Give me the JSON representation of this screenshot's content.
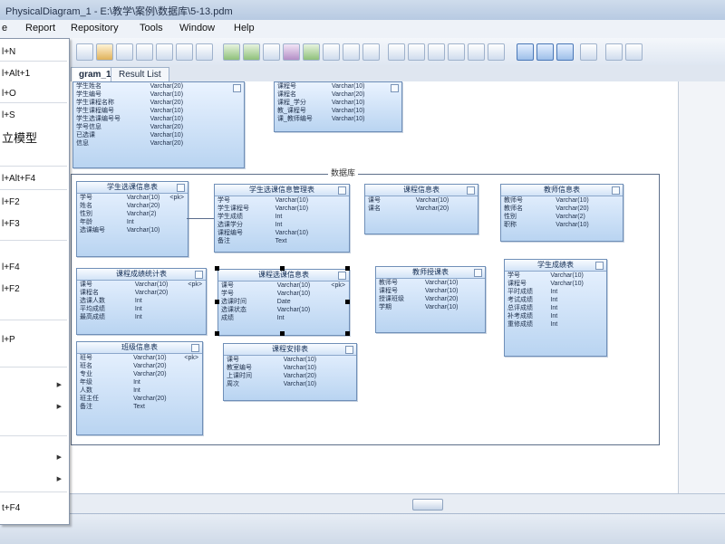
{
  "window": {
    "title": "PhysicalDiagram_1 - E:\\教学\\案例\\数据库\\5-13.pdm"
  },
  "menubar": {
    "items": [
      "e",
      "Report",
      "Repository",
      "Tools",
      "Window",
      "Help"
    ]
  },
  "tabs": [
    {
      "label": "gram_1",
      "active": true
    },
    {
      "label": "Result List",
      "active": false
    }
  ],
  "context_menu": {
    "items": [
      {
        "label": "l+N",
        "big": false,
        "arrow": false
      },
      {
        "label": "l+Alt+1",
        "big": false,
        "arrow": false
      },
      {
        "label": "l+O",
        "big": false,
        "arrow": false
      },
      {
        "label": "l+S",
        "big": false,
        "arrow": false
      },
      {
        "label": "立模型",
        "big": true,
        "arrow": false
      },
      {
        "label": "l+Alt+F4",
        "big": false,
        "arrow": false
      },
      {
        "label": "l+F2",
        "big": false,
        "arrow": false
      },
      {
        "label": "l+F3",
        "big": false,
        "arrow": false
      },
      {
        "label": "l+F4",
        "big": false,
        "arrow": false
      },
      {
        "label": "l+F2",
        "big": false,
        "arrow": false
      },
      {
        "label": "l+P",
        "big": false,
        "arrow": false
      },
      {
        "label": "",
        "big": false,
        "arrow": true
      },
      {
        "label": "",
        "big": false,
        "arrow": true
      },
      {
        "label": "",
        "big": false,
        "arrow": true
      },
      {
        "label": "",
        "big": false,
        "arrow": true
      },
      {
        "label": "t+F4",
        "big": false,
        "arrow": false
      }
    ]
  },
  "diagram": {
    "package_label": "数据库",
    "entities": [
      {
        "title": "",
        "rows": [
          [
            "学生姓名",
            "Varchar(20)",
            ""
          ],
          [
            "学生编号",
            "Varchar(10)",
            ""
          ],
          [
            "学生课程名称",
            "Varchar(20)",
            ""
          ],
          [
            "学生课程编号",
            "Varchar(10)",
            ""
          ],
          [
            "学生选课编号号",
            "Varchar(10)",
            ""
          ],
          [
            "学号信息",
            "Varchar(20)",
            ""
          ],
          [
            "已选课",
            "Varchar(10)",
            ""
          ],
          [
            "信息",
            "Varchar(20)",
            ""
          ]
        ]
      },
      {
        "title": "",
        "rows": [
          [
            "课程号",
            "Varchar(10)",
            ""
          ],
          [
            "课程名",
            "Varchar(20)",
            ""
          ],
          [
            "课程_学分",
            "Varchar(10)",
            ""
          ],
          [
            "教_课程号",
            "Varchar(10)",
            ""
          ],
          [
            "课_教师编号",
            "Varchar(10)",
            ""
          ]
        ]
      },
      {
        "title": "学生选课信息表",
        "rows": [
          [
            "学号",
            "Varchar(10)",
            "<pk>"
          ],
          [
            "姓名",
            "Varchar(20)",
            ""
          ],
          [
            "性别",
            "Varchar(2)",
            ""
          ],
          [
            "年龄",
            "Int",
            ""
          ],
          [
            "选课编号",
            "Varchar(10)",
            ""
          ]
        ]
      },
      {
        "title": "学生选课信息管理表",
        "rows": [
          [
            "学号",
            "Varchar(10)",
            ""
          ],
          [
            "学生课程号",
            "Varchar(10)",
            ""
          ],
          [
            "学生成绩",
            "Int",
            ""
          ],
          [
            "选课学分",
            "Int",
            ""
          ],
          [
            "课程编号",
            "Varchar(10)",
            ""
          ],
          [
            "备注",
            "Text",
            ""
          ]
        ]
      },
      {
        "title": "课程信息表",
        "rows": [
          [
            "课号",
            "Varchar(10)",
            ""
          ],
          [
            "课名",
            "Varchar(20)",
            ""
          ]
        ]
      },
      {
        "title": "教师信息表",
        "rows": [
          [
            "教师号",
            "Varchar(10)",
            ""
          ],
          [
            "教师名",
            "Varchar(20)",
            ""
          ],
          [
            "性别",
            "Varchar(2)",
            ""
          ],
          [
            "职称",
            "Varchar(10)",
            ""
          ]
        ]
      },
      {
        "title": "课程成绩统计表",
        "rows": [
          [
            "课号",
            "Varchar(10)",
            "<pk>"
          ],
          [
            "课程名",
            "Varchar(20)",
            ""
          ],
          [
            "选课人数",
            "Int",
            ""
          ],
          [
            "平均成绩",
            "Int",
            ""
          ],
          [
            "最高成绩",
            "Int",
            ""
          ]
        ]
      },
      {
        "title": "课程选课信息表",
        "rows": [
          [
            "课号",
            "Varchar(10)",
            "<pk>"
          ],
          [
            "学号",
            "Varchar(10)",
            ""
          ],
          [
            "选课时间",
            "Date",
            ""
          ],
          [
            "选课状态",
            "Varchar(10)",
            ""
          ],
          [
            "成绩",
            "Int",
            ""
          ]
        ]
      },
      {
        "title": "教师授课表",
        "rows": [
          [
            "教师号",
            "Varchar(10)",
            ""
          ],
          [
            "课程号",
            "Varchar(10)",
            ""
          ],
          [
            "授课班级",
            "Varchar(20)",
            ""
          ],
          [
            "学期",
            "Varchar(10)",
            ""
          ]
        ]
      },
      {
        "title": "学生成绩表",
        "rows": [
          [
            "学号",
            "Varchar(10)",
            ""
          ],
          [
            "课程号",
            "Varchar(10)",
            ""
          ],
          [
            "平时成绩",
            "Int",
            ""
          ],
          [
            "考试成绩",
            "Int",
            ""
          ],
          [
            "总评成绩",
            "Int",
            ""
          ],
          [
            "补考成绩",
            "Int",
            ""
          ],
          [
            "重修成绩",
            "Int",
            ""
          ]
        ]
      },
      {
        "title": "班级信息表",
        "rows": [
          [
            "班号",
            "Varchar(10)",
            "<pk>"
          ],
          [
            "班名",
            "Varchar(20)",
            ""
          ],
          [
            "专业",
            "Varchar(20)",
            ""
          ],
          [
            "年级",
            "Int",
            ""
          ],
          [
            "人数",
            "Int",
            ""
          ],
          [
            "班主任",
            "Varchar(20)",
            ""
          ],
          [
            "备注",
            "Text",
            ""
          ]
        ]
      },
      {
        "title": "课程安排表",
        "rows": [
          [
            "课号",
            "Varchar(10)",
            ""
          ],
          [
            "教室编号",
            "Varchar(10)",
            ""
          ],
          [
            "上课时间",
            "Varchar(20)",
            ""
          ],
          [
            "周次",
            "Varchar(10)",
            ""
          ]
        ]
      }
    ]
  }
}
